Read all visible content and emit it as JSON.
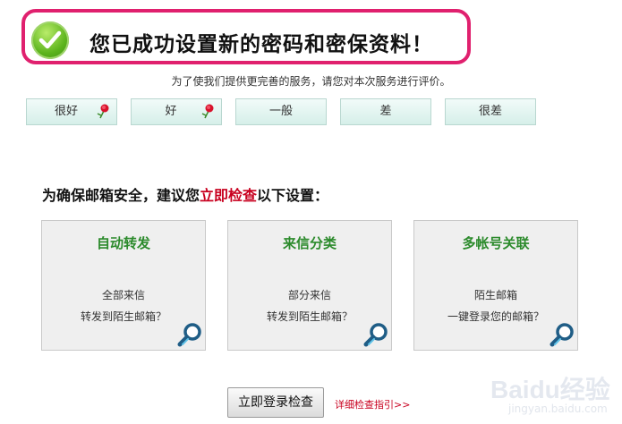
{
  "banner": {
    "title": "您已成功设置新的密码和密保资料！"
  },
  "survey": {
    "prompt": "为了使我们提供更完善的服务，请您对本次服务进行评价。",
    "options": [
      {
        "label": "很好",
        "icon": "flower-icon"
      },
      {
        "label": "好",
        "icon": "flower-icon"
      },
      {
        "label": "一般"
      },
      {
        "label": "差"
      },
      {
        "label": "很差"
      }
    ]
  },
  "security": {
    "title_prefix": "为确保邮箱安全，建议您",
    "title_highlight": "立即检查",
    "title_suffix": "以下设置：",
    "cards": [
      {
        "title": "自动转发",
        "line1": "全部来信",
        "line2": "转发到陌生邮箱？",
        "icon": "magnifier-icon"
      },
      {
        "title": "来信分类",
        "line1": "部分来信",
        "line2": "转发到陌生邮箱？",
        "icon": "magnifier-icon"
      },
      {
        "title": "多帐号关联",
        "line1": "陌生邮箱",
        "line2": "一键登录您的邮箱？",
        "icon": "magnifier-icon"
      }
    ]
  },
  "actions": {
    "check_button": "立即登录检查",
    "guide_link": "详细检查指引>>"
  },
  "watermark": {
    "brand": "Baidu经验",
    "site": "jingyan.baidu.com"
  },
  "colors": {
    "banner_border": "#e0206e",
    "check_green": "#5bb31c",
    "card_title": "#2b8a2b",
    "highlight_red": "#c8001f"
  }
}
